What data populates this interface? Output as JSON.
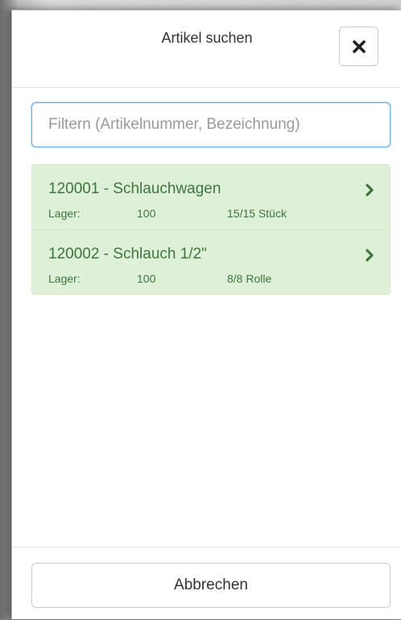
{
  "modal": {
    "title": "Artikel suchen",
    "close_icon": "close-x-icon"
  },
  "filter": {
    "placeholder": "Filtern (Artikelnummer, Bezeichnung)",
    "value": ""
  },
  "articles": [
    {
      "title": "120001 - Schlauchwagen",
      "stock_label": "Lager:",
      "stock_location": "100",
      "quantity": "15/15 Stück"
    },
    {
      "title": "120002 - Schlauch 1/2\"",
      "stock_label": "Lager:",
      "stock_location": "100",
      "quantity": "8/8 Rolle"
    }
  ],
  "footer": {
    "cancel_label": "Abbrechen"
  },
  "colors": {
    "item_background": "#dff0d8",
    "item_text": "#3c763d",
    "input_focus_border": "#66afe9"
  }
}
